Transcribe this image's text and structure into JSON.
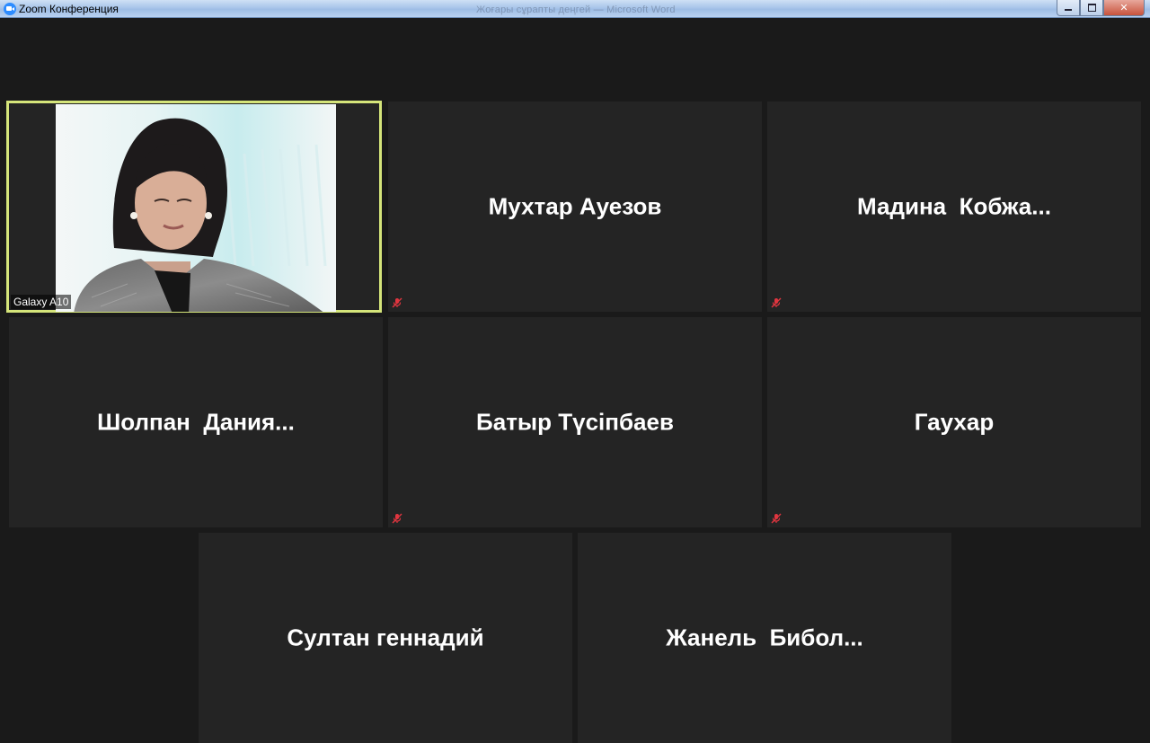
{
  "window": {
    "title": "Zoom Конференция",
    "background_title": "Жоғары сұрапты деңгей — Microsoft Word"
  },
  "tiles": [
    {
      "name": "Galaxy A10",
      "has_video": true,
      "active_speaker": true
    },
    {
      "name": "Мухтар Ауезов",
      "muted": true
    },
    {
      "name": "Мадина  Кобжа...",
      "muted": true
    },
    {
      "name": "Шолпан  Дания...",
      "muted": false
    },
    {
      "name": "Батыр Түсіпбаев",
      "muted": true
    },
    {
      "name": "Гаухар",
      "muted": true
    },
    {
      "name": "Султан геннадий",
      "muted": false
    },
    {
      "name": "Жанель  Бибол...",
      "muted": false
    }
  ],
  "colors": {
    "active_speaker_border": "#d5e57a",
    "tile_background": "#242424",
    "mute_icon": "#e0353f"
  },
  "icons": {
    "mute": "microphone-muted-icon",
    "app": "zoom-logo-icon"
  }
}
